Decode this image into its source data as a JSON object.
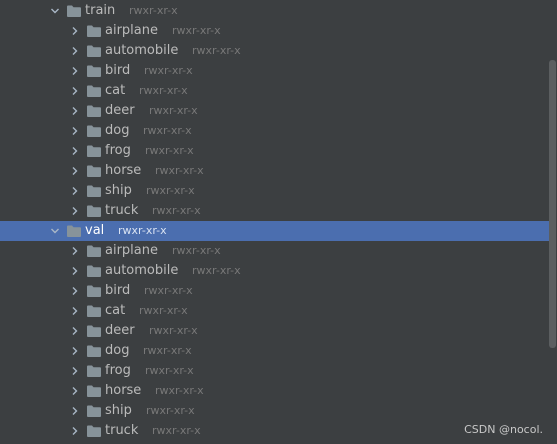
{
  "tree": {
    "rows": [
      {
        "name": "train",
        "perm": "rwxr-xr-x",
        "level": 0,
        "expanded": true,
        "selected": false
      },
      {
        "name": "airplane",
        "perm": "rwxr-xr-x",
        "level": 1,
        "expanded": false,
        "selected": false
      },
      {
        "name": "automobile",
        "perm": "rwxr-xr-x",
        "level": 1,
        "expanded": false,
        "selected": false
      },
      {
        "name": "bird",
        "perm": "rwxr-xr-x",
        "level": 1,
        "expanded": false,
        "selected": false
      },
      {
        "name": "cat",
        "perm": "rwxr-xr-x",
        "level": 1,
        "expanded": false,
        "selected": false
      },
      {
        "name": "deer",
        "perm": "rwxr-xr-x",
        "level": 1,
        "expanded": false,
        "selected": false
      },
      {
        "name": "dog",
        "perm": "rwxr-xr-x",
        "level": 1,
        "expanded": false,
        "selected": false
      },
      {
        "name": "frog",
        "perm": "rwxr-xr-x",
        "level": 1,
        "expanded": false,
        "selected": false
      },
      {
        "name": "horse",
        "perm": "rwxr-xr-x",
        "level": 1,
        "expanded": false,
        "selected": false
      },
      {
        "name": "ship",
        "perm": "rwxr-xr-x",
        "level": 1,
        "expanded": false,
        "selected": false
      },
      {
        "name": "truck",
        "perm": "rwxr-xr-x",
        "level": 1,
        "expanded": false,
        "selected": false
      },
      {
        "name": "val",
        "perm": "rwxr-xr-x",
        "level": 0,
        "expanded": true,
        "selected": true
      },
      {
        "name": "airplane",
        "perm": "rwxr-xr-x",
        "level": 1,
        "expanded": false,
        "selected": false
      },
      {
        "name": "automobile",
        "perm": "rwxr-xr-x",
        "level": 1,
        "expanded": false,
        "selected": false
      },
      {
        "name": "bird",
        "perm": "rwxr-xr-x",
        "level": 1,
        "expanded": false,
        "selected": false
      },
      {
        "name": "cat",
        "perm": "rwxr-xr-x",
        "level": 1,
        "expanded": false,
        "selected": false
      },
      {
        "name": "deer",
        "perm": "rwxr-xr-x",
        "level": 1,
        "expanded": false,
        "selected": false
      },
      {
        "name": "dog",
        "perm": "rwxr-xr-x",
        "level": 1,
        "expanded": false,
        "selected": false
      },
      {
        "name": "frog",
        "perm": "rwxr-xr-x",
        "level": 1,
        "expanded": false,
        "selected": false
      },
      {
        "name": "horse",
        "perm": "rwxr-xr-x",
        "level": 1,
        "expanded": false,
        "selected": false
      },
      {
        "name": "ship",
        "perm": "rwxr-xr-x",
        "level": 1,
        "expanded": false,
        "selected": false
      },
      {
        "name": "truck",
        "perm": "rwxr-xr-x",
        "level": 1,
        "expanded": false,
        "selected": false
      }
    ]
  },
  "watermark": "CSDN @nocol.",
  "colors": {
    "background": "#3c3f41",
    "selection": "#4b6eaf",
    "folder": "#87939a",
    "permissions": "#787878"
  },
  "icons": {
    "expanded": "chevron-down-icon",
    "collapsed": "chevron-right-icon",
    "folder": "folder-icon"
  }
}
